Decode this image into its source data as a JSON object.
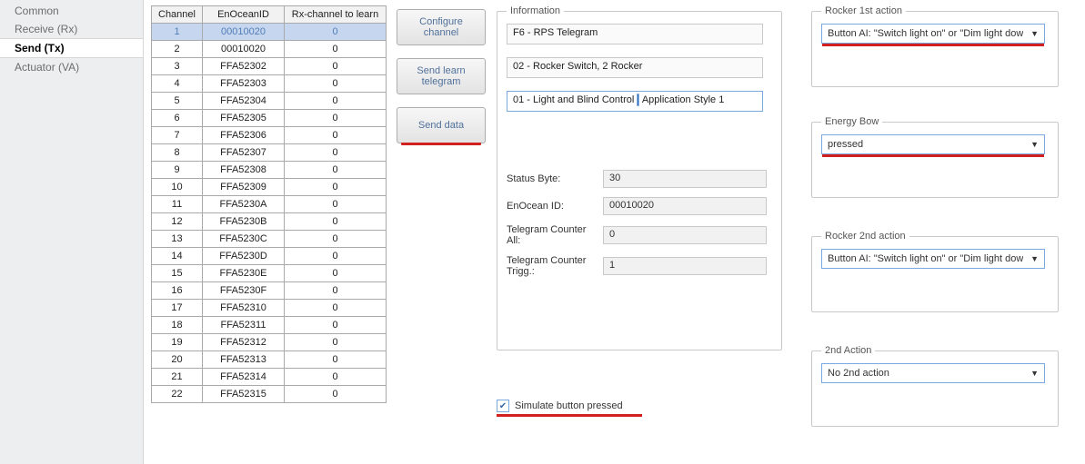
{
  "sidebar": {
    "items": [
      {
        "label": "Common"
      },
      {
        "label": "Receive (Rx)"
      },
      {
        "label": "Send (Tx)"
      },
      {
        "label": "Actuator (VA)"
      }
    ],
    "selected_index": 2
  },
  "table": {
    "headers": [
      "Channel",
      "EnOceanID",
      "Rx-channel to learn"
    ],
    "rows": [
      {
        "ch": "1",
        "id": "00010020",
        "rx": "0",
        "selected": true
      },
      {
        "ch": "2",
        "id": "00010020",
        "rx": "0"
      },
      {
        "ch": "3",
        "id": "FFA52302",
        "rx": "0"
      },
      {
        "ch": "4",
        "id": "FFA52303",
        "rx": "0"
      },
      {
        "ch": "5",
        "id": "FFA52304",
        "rx": "0"
      },
      {
        "ch": "6",
        "id": "FFA52305",
        "rx": "0"
      },
      {
        "ch": "7",
        "id": "FFA52306",
        "rx": "0"
      },
      {
        "ch": "8",
        "id": "FFA52307",
        "rx": "0"
      },
      {
        "ch": "9",
        "id": "FFA52308",
        "rx": "0"
      },
      {
        "ch": "10",
        "id": "FFA52309",
        "rx": "0"
      },
      {
        "ch": "11",
        "id": "FFA5230A",
        "rx": "0"
      },
      {
        "ch": "12",
        "id": "FFA5230B",
        "rx": "0"
      },
      {
        "ch": "13",
        "id": "FFA5230C",
        "rx": "0"
      },
      {
        "ch": "14",
        "id": "FFA5230D",
        "rx": "0"
      },
      {
        "ch": "15",
        "id": "FFA5230E",
        "rx": "0"
      },
      {
        "ch": "16",
        "id": "FFA5230F",
        "rx": "0"
      },
      {
        "ch": "17",
        "id": "FFA52310",
        "rx": "0"
      },
      {
        "ch": "18",
        "id": "FFA52311",
        "rx": "0"
      },
      {
        "ch": "19",
        "id": "FFA52312",
        "rx": "0"
      },
      {
        "ch": "20",
        "id": "FFA52313",
        "rx": "0"
      },
      {
        "ch": "21",
        "id": "FFA52314",
        "rx": "0"
      },
      {
        "ch": "22",
        "id": "FFA52315",
        "rx": "0"
      }
    ]
  },
  "buttons": {
    "configure": "Configure\nchannel",
    "learn": "Send learn\ntelegram",
    "send": "Send data"
  },
  "info": {
    "legend": "Information",
    "line1": "F6 - RPS Telegram",
    "line2": "02 - Rocker Switch, 2 Rocker",
    "line3a": "01 - Light and Blind Control ",
    "line3b": " Application Style 1",
    "status_label": "Status Byte:",
    "status_value": "30",
    "id_label": "EnOcean ID:",
    "id_value": "00010020",
    "tc_all_label": "Telegram Counter All:",
    "tc_all_value": "0",
    "tc_trigg_label": "Telegram Counter Trigg.:",
    "tc_trigg_value": "1"
  },
  "simulate": {
    "label": "Simulate button pressed",
    "checked": true
  },
  "rocker1": {
    "legend": "Rocker 1st action",
    "value": "Button AI: \"Switch light on\" or \"Dim light dow"
  },
  "energy_bow": {
    "legend": "Energy Bow",
    "value": "pressed"
  },
  "rocker2": {
    "legend": "Rocker 2nd action",
    "value": "Button AI: \"Switch light on\" or \"Dim light dow"
  },
  "action2": {
    "legend": "2nd Action",
    "value": "No 2nd action"
  }
}
